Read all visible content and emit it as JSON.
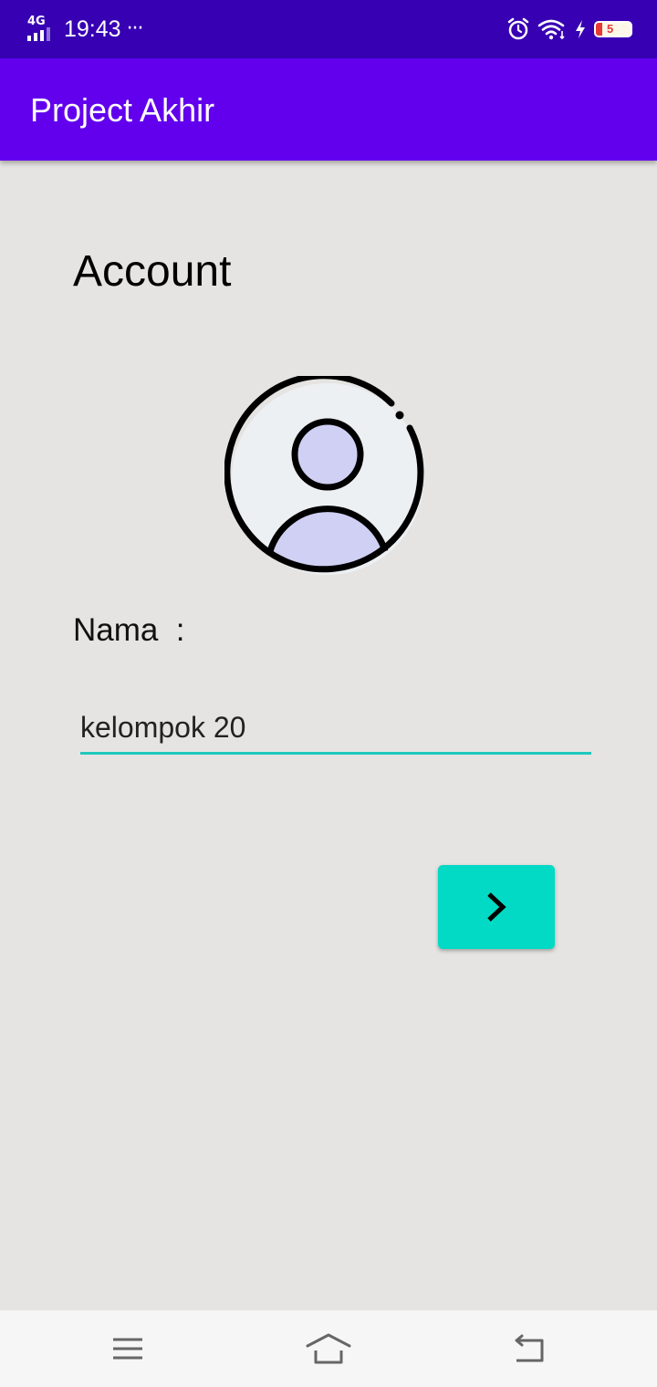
{
  "status_bar": {
    "network": "4G",
    "time": "19:43",
    "more": "···",
    "battery_level": "5",
    "battery_fraction": 0.05,
    "icons": [
      "alarm-icon",
      "wifi-icon",
      "charging-icon",
      "battery-icon"
    ]
  },
  "app_bar": {
    "title": "Project Akhir"
  },
  "main": {
    "heading": "Account",
    "avatar_icon": "user-avatar-icon",
    "name_label": "Nama  :",
    "name_value": "kelompok 20",
    "next_icon": "chevron-right-icon"
  },
  "nav_bar": {
    "icons": [
      "menu-icon",
      "home-icon",
      "back-icon"
    ]
  },
  "colors": {
    "status_bar": "#3700b3",
    "app_bar": "#6200ee",
    "background": "#e5e4e2",
    "accent": "#03dac5",
    "input_underline": "#1fc8be",
    "avatar_fill": "#ecf0f3",
    "avatar_person": "#cfd0f3"
  }
}
